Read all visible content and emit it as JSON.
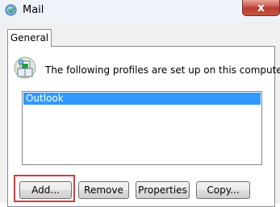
{
  "window": {
    "title": "Mail",
    "title_icon": "mail-globe-icon",
    "close_glyph": "x"
  },
  "tabs": [
    {
      "label": "General",
      "selected": true
    }
  ],
  "general": {
    "info_text": "The following profiles are set up on this computer:",
    "profile_icon": "profiles-icon",
    "profiles": [
      {
        "name": "Outlook",
        "selected": true
      }
    ]
  },
  "buttons": {
    "add": "Add...",
    "remove": "Remove",
    "properties": "Properties",
    "copy": "Copy..."
  },
  "colors": {
    "selection": "#3399ff",
    "highlight_box": "#d9373a",
    "close_button": "#c75050"
  }
}
